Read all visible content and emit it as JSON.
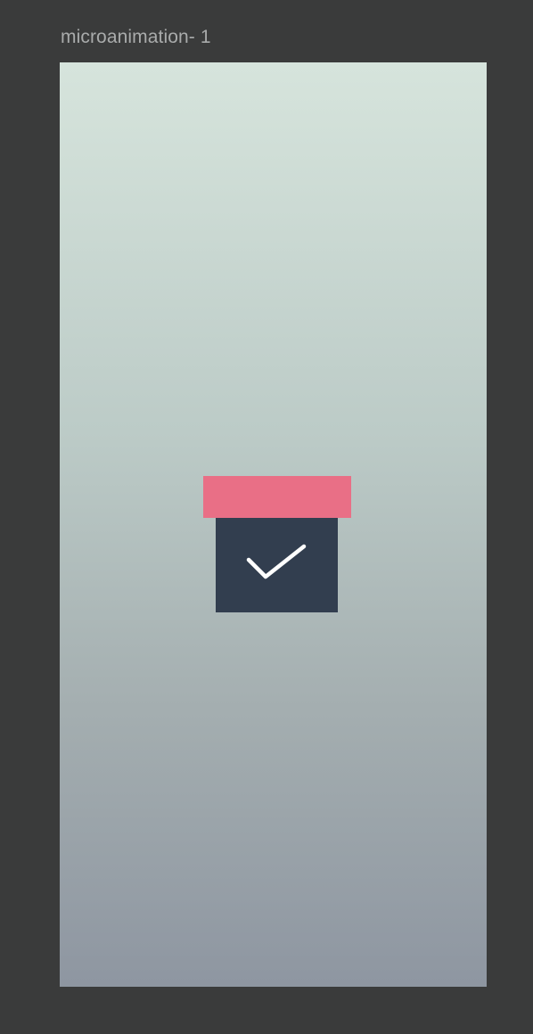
{
  "frame": {
    "label": "microanimation- 1"
  },
  "colors": {
    "canvas_background": "#3a3b3b",
    "label_text": "#a9abab",
    "gradient_top": "#d6e4dc",
    "gradient_bottom": "#8e96a1",
    "lid": "#e96f86",
    "box": "#323e4f",
    "check": "#ffffff"
  },
  "icons": {
    "check": "checkmark-icon"
  }
}
